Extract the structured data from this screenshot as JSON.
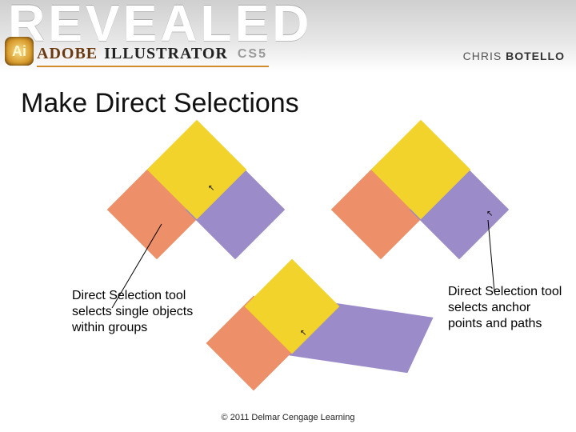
{
  "header": {
    "revealed": "REVEALED",
    "brand": "ADOBE",
    "product": "ILLUSTRATOR",
    "version": "CS5",
    "logo_label": "Ai",
    "author_first": "CHRIS",
    "author_last": "BOTELLO"
  },
  "slide": {
    "title": "Make Direct Selections"
  },
  "callouts": {
    "left": "Direct Selection tool selects single objects within groups",
    "right": "Direct Selection tool selects anchor points and paths"
  },
  "footer": {
    "copyright": "© 2011 Delmar Cengage Learning"
  },
  "colors": {
    "yellow": "#f2d32b",
    "salmon": "#ed8f68",
    "violet": "#9b8bc9"
  }
}
